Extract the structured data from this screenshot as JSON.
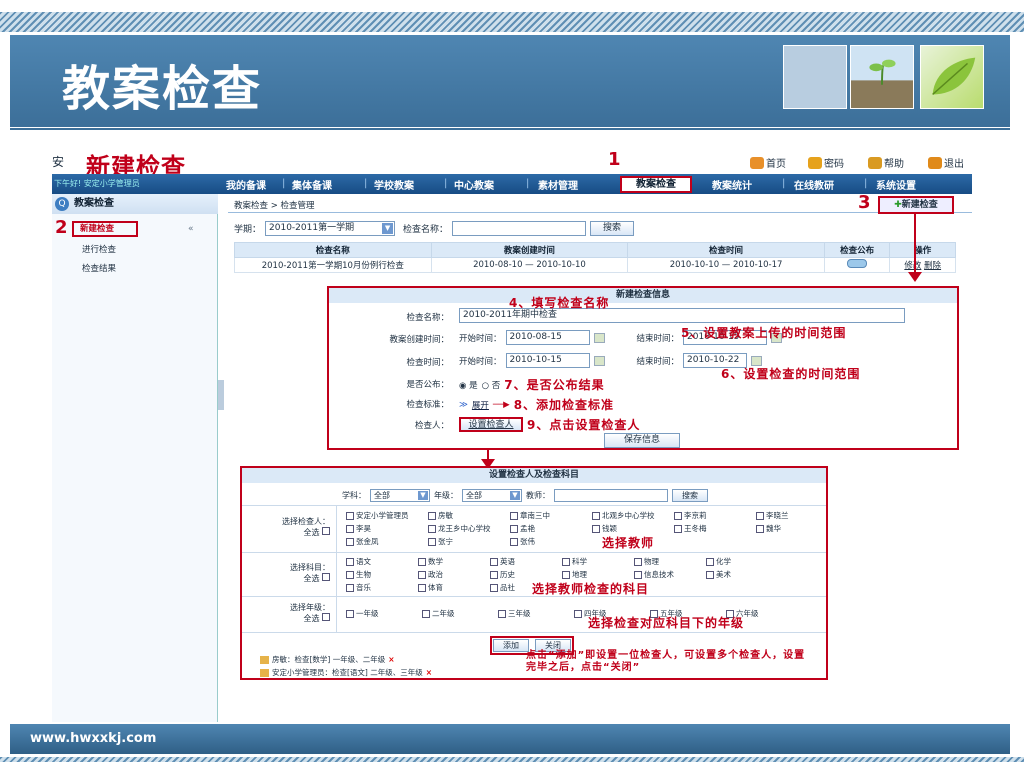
{
  "slide": {
    "title": "教案检查",
    "footer_url": "www.hwxxkj.com"
  },
  "topbar": {
    "partial_char": "安",
    "callout_title": "新建检查",
    "links": [
      "首页",
      "密码",
      "帮助",
      "退出"
    ],
    "link_icon_colors": [
      "#e8902a",
      "#e6a21c",
      "#d99a22",
      "#e08a1a"
    ]
  },
  "nav": {
    "welcome": "下午好! 安定小学管理员",
    "tabs": [
      "我的备课",
      "集体备课",
      "学校教案",
      "中心教案",
      "素材管理",
      "教案检查",
      "教案统计",
      "在线教研",
      "系统设置"
    ],
    "step_marker": "1"
  },
  "sidebar": {
    "header": "教案检查",
    "items": [
      "新建检查",
      "进行检查",
      "检查结果"
    ],
    "collapse": "«",
    "step_marker": "2"
  },
  "breadcrumb": "教案检查 > 检查管理",
  "new_button": {
    "label": "新建检查",
    "step_marker": "3"
  },
  "filter": {
    "term_label": "学期：",
    "term_value": "2010-2011第一学期",
    "name_label": "检查名称：",
    "name_value": "",
    "search": "搜索"
  },
  "list": {
    "headers": [
      "检查名称",
      "教案创建时间",
      "检查时间",
      "检查公布",
      "操作"
    ],
    "rows": [
      {
        "name": "2010-2011第一学期10月份例行检查",
        "created": "2010-08-10 — 2010-10-10",
        "check": "2010-10-10 — 2010-10-17",
        "publish": "",
        "op_edit": "修改",
        "op_delete": "删除"
      }
    ]
  },
  "new_form": {
    "title": "新建检查信息",
    "name_label": "检查名称：",
    "name_value": "2010-2011年期中检查",
    "created_label": "教案创建时间：",
    "created_start_label": "开始时间：",
    "created_start": "2010-08-15",
    "created_end_label": "结束时间：",
    "created_end": "2010-10-15",
    "check_label": "检查时间：",
    "check_start_label": "开始时间：",
    "check_start": "2010-10-15",
    "check_end_label": "结束时间：",
    "check_end": "2010-10-22",
    "publish_label": "是否公布：",
    "publish_yes": "是",
    "publish_no": "否",
    "standard_label": "检查标准：",
    "expand": "展开",
    "checker_label": "检查人：",
    "set_checker": "设置检查人",
    "save": "保存信息",
    "annotations": {
      "a4": "4、填写检查名称",
      "a5": "5、设置教案上传的时间范围",
      "a6": "6、设置检查的时间范围",
      "a7": "7、是否公布结果",
      "a8": "8、添加检查标准",
      "a9": "9、点击设置检查人"
    }
  },
  "checker_form": {
    "title": "设置检查人及检查科目",
    "subject_label": "学科：",
    "subject_value": "全部",
    "grade_label": "年级：",
    "grade_value": "全部",
    "teacher_label": "教师：",
    "teacher_value": "",
    "search": "搜索",
    "select_teacher_label": "选择检查人：",
    "select_subject_label": "选择科目：",
    "select_grade_label": "选择年级：",
    "select_all": "全选",
    "teachers": [
      [
        "安定小学管理员",
        "房敏",
        "章南三中",
        "北观乡中心学校",
        "李京莉",
        "李晓兰"
      ],
      [
        "李昊",
        "龙王乡中心学校",
        "孟艳",
        "钱颖",
        "王冬梅",
        "魏华"
      ],
      [
        "张金凤",
        "张宁",
        "张伟"
      ]
    ],
    "subjects": [
      [
        "语文",
        "数学",
        "英语",
        "科学",
        "物理",
        "化学"
      ],
      [
        "生物",
        "政治",
        "历史",
        "地理",
        "信息技术",
        "美术"
      ],
      [
        "音乐",
        "体育",
        "品社"
      ]
    ],
    "grades": [
      "一年级",
      "二年级",
      "三年级",
      "四年级",
      "五年级",
      "六年级"
    ],
    "add": "添加",
    "close": "关闭",
    "summary": [
      {
        "text": "房敏：检查[数学] 一年级、二年级",
        "x": "×"
      },
      {
        "text": "安定小学管理员：检查[语文] 二年级、三年级",
        "x": "×"
      }
    ],
    "annotations": {
      "teacher": "选择教师",
      "subject": "选择教师检查的科目",
      "grade": "选择检查对应科目下的年级",
      "note": "点击“添加”即设置一位检查人，可设置多个检查人，设置完毕之后，点击“关闭”"
    }
  }
}
